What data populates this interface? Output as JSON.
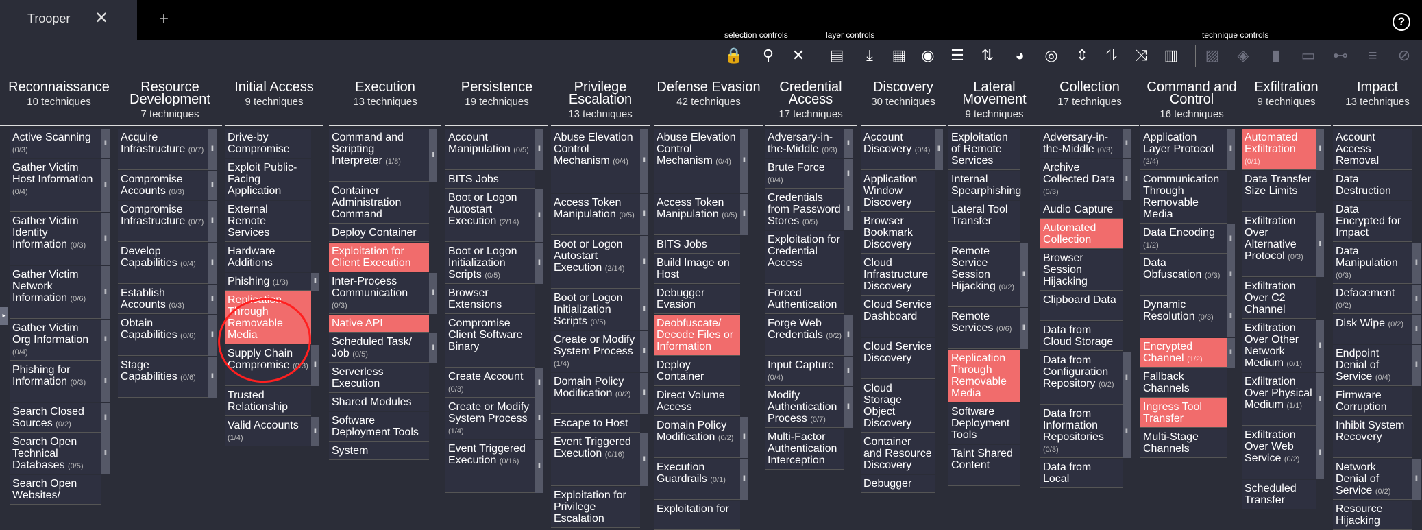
{
  "tab": {
    "title": "Trooper",
    "close": "✕",
    "add": "+"
  },
  "help": "?",
  "toolbar": {
    "selection_label": "selection controls",
    "layer_label": "layer controls",
    "technique_label": "technique controls"
  },
  "tactics": [
    {
      "name": "Reconnaissance",
      "count": "10 techniques",
      "items": [
        {
          "label": "Active Scanning",
          "sub": "(0/3)"
        },
        {
          "label": "Gather Victim Host Information",
          "sub": "(0/4)"
        },
        {
          "label": "Gather Victim Identity Information",
          "sub": "(0/3)"
        },
        {
          "label": "Gather Victim Network Information",
          "sub": "(0/6)"
        },
        {
          "label": "Gather Victim Org Information",
          "sub": "(0/4)"
        },
        {
          "label": "Phishing for Information",
          "sub": "(0/3)"
        },
        {
          "label": "Search Closed Sources",
          "sub": "(0/2)"
        },
        {
          "label": "Search Open Technical Databases",
          "sub": "(0/5)"
        },
        {
          "label": "Search Open Websites/",
          "sub": ""
        }
      ]
    },
    {
      "name": "Resource Development",
      "count": "7 techniques",
      "items": [
        {
          "label": "Acquire Infrastructure",
          "sub": "(0/7)"
        },
        {
          "label": "Compromise Accounts",
          "sub": "(0/3)"
        },
        {
          "label": "Compromise Infrastructure",
          "sub": "(0/7)"
        },
        {
          "label": "Develop Capabilities",
          "sub": "(0/4)"
        },
        {
          "label": "Establish Accounts",
          "sub": "(0/3)"
        },
        {
          "label": "Obtain Capabilities",
          "sub": "(0/6)"
        },
        {
          "label": "Stage Capabilities",
          "sub": "(0/6)"
        }
      ]
    },
    {
      "name": "Initial Access",
      "count": "9 techniques",
      "items": [
        {
          "label": "Drive-by Compromise",
          "sub": ""
        },
        {
          "label": "Exploit Public-Facing Application",
          "sub": ""
        },
        {
          "label": "External Remote Services",
          "sub": ""
        },
        {
          "label": "Hardware Additions",
          "sub": ""
        },
        {
          "label": "Phishing",
          "sub": "(1/3)"
        },
        {
          "label": "Replication Through Removable Media",
          "sub": "",
          "hl": true
        },
        {
          "label": "Supply Chain Compromise",
          "sub": "(0/3)"
        },
        {
          "label": "Trusted Relationship",
          "sub": ""
        },
        {
          "label": "Valid Accounts",
          "sub": "(1/4)"
        }
      ]
    },
    {
      "name": "Execution",
      "count": "13 techniques",
      "items": [
        {
          "label": "Command and Scripting Interpreter",
          "sub": "(1/8)"
        },
        {
          "label": "Container Administration Command",
          "sub": ""
        },
        {
          "label": "Deploy Container",
          "sub": ""
        },
        {
          "label": "Exploitation for Client Execution",
          "sub": "",
          "hl": true
        },
        {
          "label": "Inter-Process Communication",
          "sub": "(0/3)"
        },
        {
          "label": "Native API",
          "sub": "",
          "hl": true
        },
        {
          "label": "Scheduled Task/ Job",
          "sub": "(0/5)"
        },
        {
          "label": "Serverless Execution",
          "sub": ""
        },
        {
          "label": "Shared Modules",
          "sub": ""
        },
        {
          "label": "Software Deployment Tools",
          "sub": ""
        },
        {
          "label": "System",
          "sub": ""
        }
      ]
    },
    {
      "name": "Persistence",
      "count": "19 techniques",
      "items": [
        {
          "label": "Account Manipulation",
          "sub": "(0/5)"
        },
        {
          "label": "BITS Jobs",
          "sub": ""
        },
        {
          "label": "Boot or Logon Autostart Execution",
          "sub": "(2/14)"
        },
        {
          "label": "Boot or Logon Initialization Scripts",
          "sub": "(0/5)"
        },
        {
          "label": "Browser Extensions",
          "sub": ""
        },
        {
          "label": "Compromise Client Software Binary",
          "sub": ""
        },
        {
          "label": "Create Account",
          "sub": "(0/3)"
        },
        {
          "label": "Create or Modify System Process",
          "sub": "(1/4)"
        },
        {
          "label": "Event Triggered Execution",
          "sub": "(0/16)"
        }
      ]
    },
    {
      "name": "Privilege Escalation",
      "count": "13 techniques",
      "items": [
        {
          "label": "Abuse Elevation Control Mechanism",
          "sub": "(0/4)"
        },
        {
          "label": "Access Token Manipulation",
          "sub": "(0/5)"
        },
        {
          "label": "Boot or Logon Autostart Execution",
          "sub": "(2/14)"
        },
        {
          "label": "Boot or Logon Initialization Scripts",
          "sub": "(0/5)"
        },
        {
          "label": "Create or Modify System Process",
          "sub": "(1/4)"
        },
        {
          "label": "Domain Policy Modification",
          "sub": "(0/2)"
        },
        {
          "label": "Escape to Host",
          "sub": ""
        },
        {
          "label": "Event Triggered Execution",
          "sub": "(0/16)"
        },
        {
          "label": "Exploitation for Privilege Escalation",
          "sub": ""
        }
      ]
    },
    {
      "name": "Defense Evasion",
      "count": "42 techniques",
      "items": [
        {
          "label": "Abuse Elevation Control Mechanism",
          "sub": "(0/4)"
        },
        {
          "label": "Access Token Manipulation",
          "sub": "(0/5)"
        },
        {
          "label": "BITS Jobs",
          "sub": ""
        },
        {
          "label": "Build Image on Host",
          "sub": ""
        },
        {
          "label": "Debugger Evasion",
          "sub": ""
        },
        {
          "label": "Deobfuscate/ Decode Files or Information",
          "sub": "",
          "hl": true
        },
        {
          "label": "Deploy Container",
          "sub": ""
        },
        {
          "label": "Direct Volume Access",
          "sub": ""
        },
        {
          "label": "Domain Policy Modification",
          "sub": "(0/2)"
        },
        {
          "label": "Execution Guardrails",
          "sub": "(0/1)"
        },
        {
          "label": "Exploitation for",
          "sub": ""
        }
      ]
    },
    {
      "name": "Credential Access",
      "count": "17 techniques",
      "items": [
        {
          "label": "Adversary-in-the-Middle",
          "sub": "(0/3)"
        },
        {
          "label": "Brute Force",
          "sub": "(0/4)"
        },
        {
          "label": "Credentials from Password Stores",
          "sub": "(0/5)"
        },
        {
          "label": "Exploitation for Credential Access",
          "sub": ""
        },
        {
          "label": "Forced Authentication",
          "sub": ""
        },
        {
          "label": "Forge Web Credentials",
          "sub": "(0/2)"
        },
        {
          "label": "Input Capture",
          "sub": "(0/4)"
        },
        {
          "label": "Modify Authentication Process",
          "sub": "(0/7)"
        },
        {
          "label": "Multi-Factor Authentication Interception",
          "sub": ""
        }
      ]
    },
    {
      "name": "Discovery",
      "count": "30 techniques",
      "items": [
        {
          "label": "Account Discovery",
          "sub": "(0/4)"
        },
        {
          "label": "Application Window Discovery",
          "sub": ""
        },
        {
          "label": "Browser Bookmark Discovery",
          "sub": ""
        },
        {
          "label": "Cloud Infrastructure Discovery",
          "sub": ""
        },
        {
          "label": "Cloud Service Dashboard",
          "sub": ""
        },
        {
          "label": "Cloud Service Discovery",
          "sub": ""
        },
        {
          "label": "Cloud Storage Object Discovery",
          "sub": ""
        },
        {
          "label": "Container and Resource Discovery",
          "sub": ""
        },
        {
          "label": "Debugger",
          "sub": ""
        }
      ]
    },
    {
      "name": "Lateral Movement",
      "count": "9 techniques",
      "items": [
        {
          "label": "Exploitation of Remote Services",
          "sub": ""
        },
        {
          "label": "Internal Spearphishing",
          "sub": ""
        },
        {
          "label": "Lateral Tool Transfer",
          "sub": ""
        },
        {
          "label": "Remote Service Session Hijacking",
          "sub": "(0/2)"
        },
        {
          "label": "Remote Services",
          "sub": "(0/6)"
        },
        {
          "label": "Replication Through Removable Media",
          "sub": "",
          "hl": true
        },
        {
          "label": "Software Deployment Tools",
          "sub": ""
        },
        {
          "label": "Taint Shared Content",
          "sub": ""
        }
      ]
    },
    {
      "name": "Collection",
      "count": "17 techniques",
      "items": [
        {
          "label": "Adversary-in-the-Middle",
          "sub": "(0/3)"
        },
        {
          "label": "Archive Collected Data",
          "sub": "(0/3)"
        },
        {
          "label": "Audio Capture",
          "sub": ""
        },
        {
          "label": "Automated Collection",
          "sub": "",
          "hl": true
        },
        {
          "label": "Browser Session Hijacking",
          "sub": ""
        },
        {
          "label": "Clipboard Data",
          "sub": ""
        },
        {
          "label": "Data from Cloud Storage",
          "sub": ""
        },
        {
          "label": "Data from Configuration Repository",
          "sub": "(0/2)"
        },
        {
          "label": "Data from Information Repositories",
          "sub": "(0/3)"
        },
        {
          "label": "Data from Local",
          "sub": ""
        }
      ]
    },
    {
      "name": "Command and Control",
      "count": "16 techniques",
      "items": [
        {
          "label": "Application Layer Protocol",
          "sub": "(2/4)"
        },
        {
          "label": "Communication Through Removable Media",
          "sub": ""
        },
        {
          "label": "Data Encoding",
          "sub": "(1/2)"
        },
        {
          "label": "Data Obfuscation",
          "sub": "(0/3)"
        },
        {
          "label": "Dynamic Resolution",
          "sub": "(0/3)"
        },
        {
          "label": "Encrypted Channel",
          "sub": "(1/2)",
          "hl": true
        },
        {
          "label": "Fallback Channels",
          "sub": ""
        },
        {
          "label": "Ingress Tool Transfer",
          "sub": "",
          "hl": true
        },
        {
          "label": "Multi-Stage Channels",
          "sub": ""
        }
      ]
    },
    {
      "name": "Exfiltration",
      "count": "9 techniques",
      "items": [
        {
          "label": "Automated Exfiltration",
          "sub": "(0/1)",
          "hl": true
        },
        {
          "label": "Data Transfer Size Limits",
          "sub": ""
        },
        {
          "label": "Exfiltration Over Alternative Protocol",
          "sub": "(0/3)"
        },
        {
          "label": "Exfiltration Over C2 Channel",
          "sub": ""
        },
        {
          "label": "Exfiltration Over Other Network Medium",
          "sub": "(0/1)"
        },
        {
          "label": "Exfiltration Over Physical Medium",
          "sub": "(1/1)"
        },
        {
          "label": "Exfiltration Over Web Service",
          "sub": "(0/2)"
        },
        {
          "label": "Scheduled Transfer",
          "sub": ""
        }
      ]
    },
    {
      "name": "Impact",
      "count": "13 techniques",
      "items": [
        {
          "label": "Account Access Removal",
          "sub": ""
        },
        {
          "label": "Data Destruction",
          "sub": ""
        },
        {
          "label": "Data Encrypted for Impact",
          "sub": ""
        },
        {
          "label": "Data Manipulation",
          "sub": "(0/3)"
        },
        {
          "label": "Defacement",
          "sub": "(0/2)"
        },
        {
          "label": "Disk Wipe",
          "sub": "(0/2)"
        },
        {
          "label": "Endpoint Denial of Service",
          "sub": "(0/4)"
        },
        {
          "label": "Firmware Corruption",
          "sub": ""
        },
        {
          "label": "Inhibit System Recovery",
          "sub": ""
        },
        {
          "label": "Network Denial of Service",
          "sub": "(0/2)"
        },
        {
          "label": "Resource Hijacking",
          "sub": ""
        }
      ]
    }
  ]
}
